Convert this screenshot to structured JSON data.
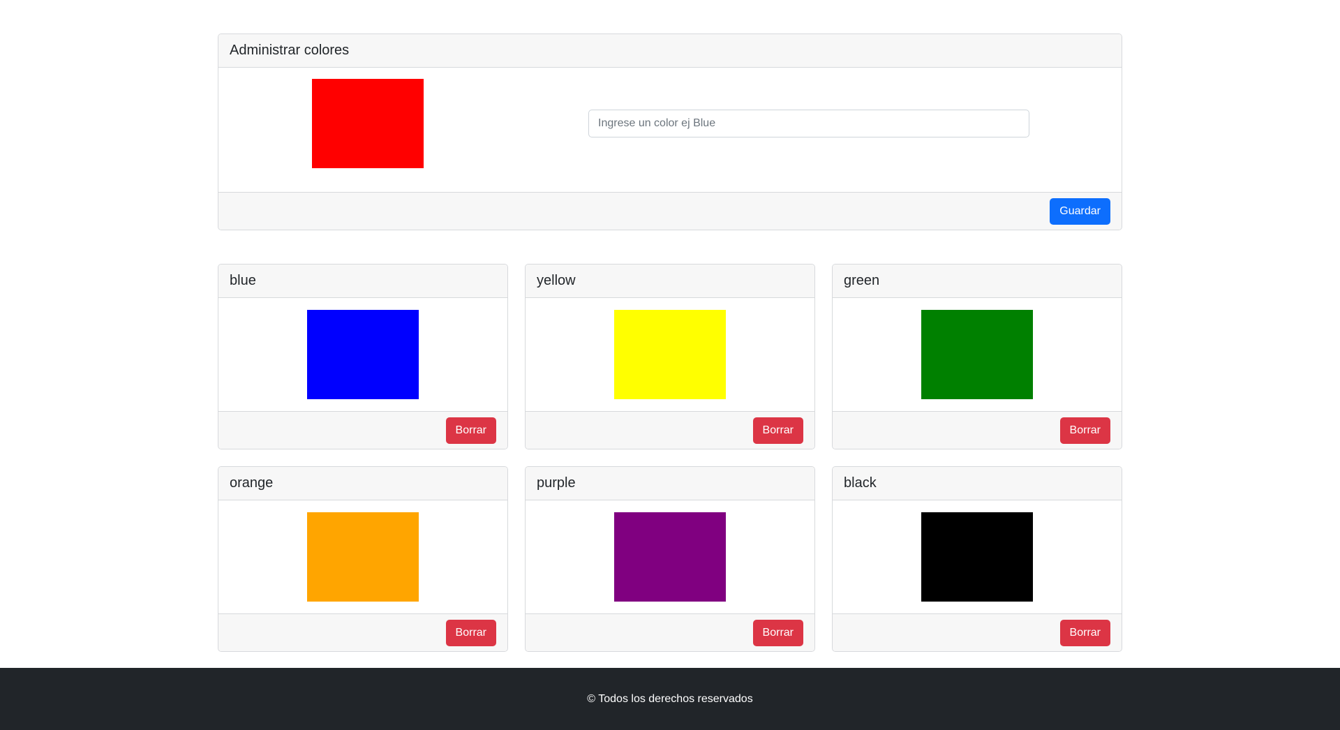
{
  "admin": {
    "title": "Administrar colores",
    "current_color": "red",
    "input_placeholder": "Ingrese un color ej Blue",
    "input_value": "",
    "save_label": "Guardar"
  },
  "colors": [
    {
      "name": "blue",
      "color": "blue",
      "delete_label": "Borrar"
    },
    {
      "name": "yellow",
      "color": "yellow",
      "delete_label": "Borrar"
    },
    {
      "name": "green",
      "color": "green",
      "delete_label": "Borrar"
    },
    {
      "name": "orange",
      "color": "orange",
      "delete_label": "Borrar"
    },
    {
      "name": "purple",
      "color": "purple",
      "delete_label": "Borrar"
    },
    {
      "name": "black",
      "color": "black",
      "delete_label": "Borrar"
    }
  ],
  "footer": {
    "text": "© Todos los derechos reservados"
  },
  "theme": {
    "primary": "#0d6efd",
    "danger": "#dc3545",
    "footer_bg": "#212529"
  }
}
